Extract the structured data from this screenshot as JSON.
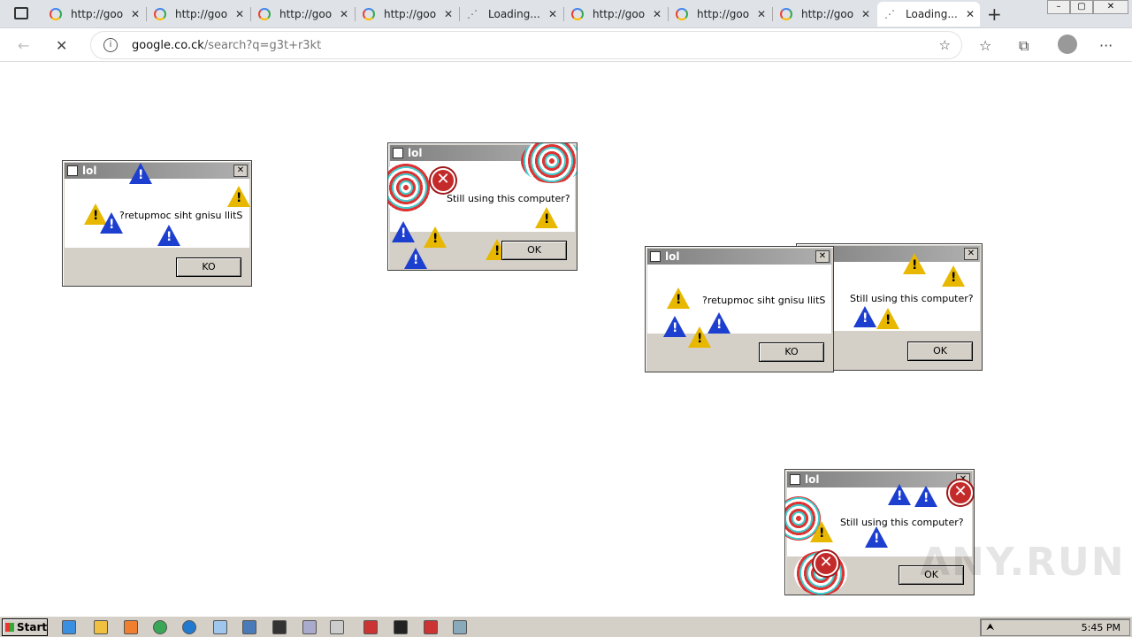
{
  "browser": {
    "tabs": [
      {
        "title": "http://goo",
        "icon": "google-icon"
      },
      {
        "title": "http://goo",
        "icon": "google-icon"
      },
      {
        "title": "http://goo",
        "icon": "google-icon"
      },
      {
        "title": "http://goo",
        "icon": "google-icon"
      },
      {
        "title": "Loading...",
        "icon": "spinner-icon"
      },
      {
        "title": "http://goo",
        "icon": "google-icon"
      },
      {
        "title": "http://goo",
        "icon": "google-icon"
      },
      {
        "title": "http://goo",
        "icon": "google-icon"
      },
      {
        "title": "Loading...",
        "icon": "spinner-icon",
        "active": true
      }
    ],
    "address": {
      "domain": "google.co.ck",
      "path": "/search?q=g3t+r3kt"
    }
  },
  "dialogs": [
    {
      "title": "lol",
      "message": "?retupmoc siht gnisu llitS",
      "button": "KO"
    },
    {
      "title": "lol",
      "message": "Still using this computer?",
      "button": "OK"
    },
    {
      "title": "lol",
      "message": "?retupmoc siht gnisu llitS",
      "button": "KO"
    },
    {
      "title": "lol",
      "message": "Still using this computer?",
      "button": "OK"
    },
    {
      "title": "lol",
      "message": "Still using this computer?",
      "button": "OK"
    }
  ],
  "taskbar": {
    "start_label": "Start",
    "clock": "5:45 PM"
  },
  "watermark": "ANY.RUN"
}
